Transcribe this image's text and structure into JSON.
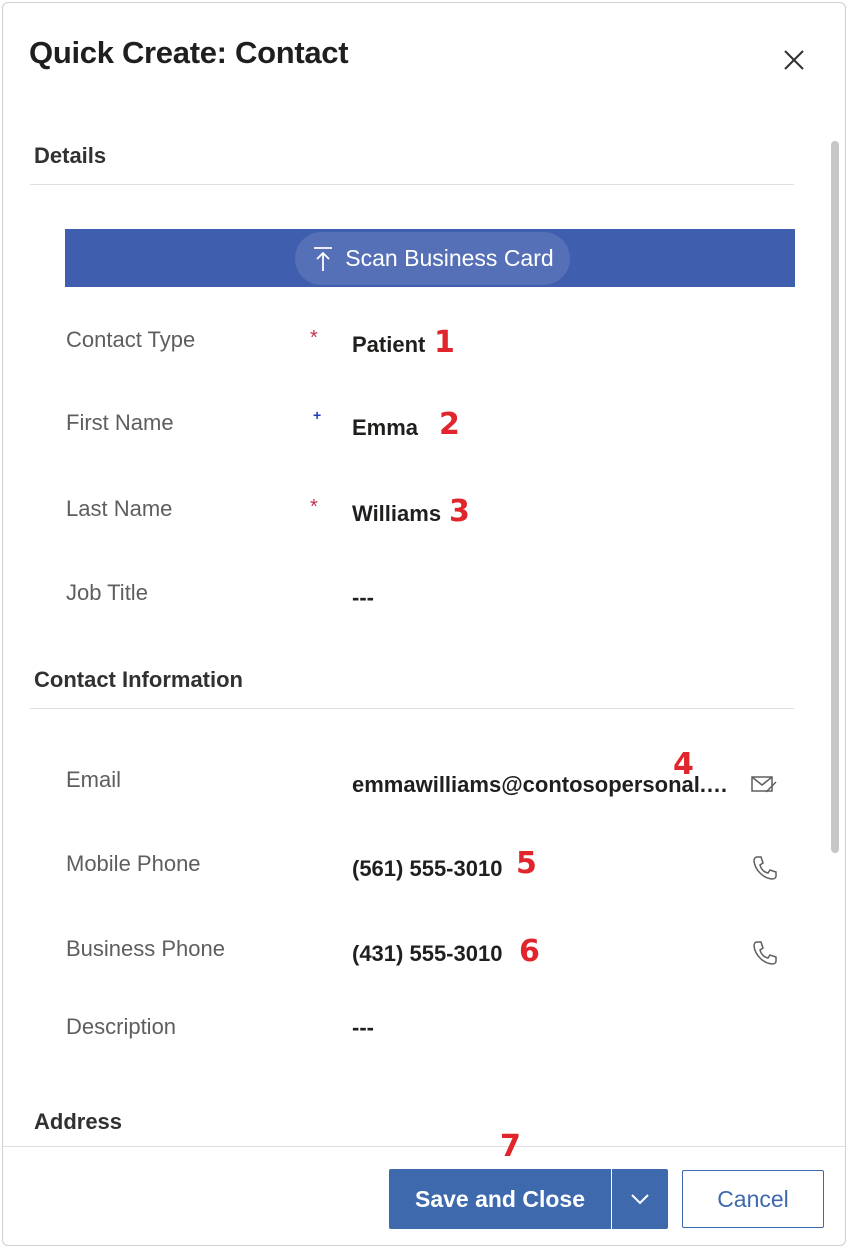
{
  "dialog": {
    "title": "Quick Create: Contact",
    "close_icon": "close-icon"
  },
  "details": {
    "section_title": "Details",
    "scan_button_label": "Scan Business Card",
    "fields": [
      {
        "label": "Contact Type",
        "value": "Patient",
        "required": "*",
        "marker": "1"
      },
      {
        "label": "First Name",
        "value": "Emma",
        "recommended": "+",
        "marker": "2"
      },
      {
        "label": "Last Name",
        "value": "Williams",
        "required": "*",
        "marker": "3"
      },
      {
        "label": "Job Title",
        "value": "---"
      }
    ]
  },
  "contact_info": {
    "section_title": "Contact Information",
    "fields": [
      {
        "label": "Email",
        "value": "emmawilliams@contosopersonal.com",
        "marker": "4",
        "icon": "email-icon"
      },
      {
        "label": "Mobile Phone",
        "value": "(561) 555-3010",
        "marker": "5",
        "icon": "phone-icon"
      },
      {
        "label": "Business Phone",
        "value": "(431) 555-3010",
        "marker": "6",
        "icon": "phone-icon"
      },
      {
        "label": "Description",
        "value": "---"
      }
    ]
  },
  "address": {
    "section_title": "Address"
  },
  "footer": {
    "save_label": "Save and Close",
    "save_marker": "7",
    "dropdown_icon": "chevron-down-icon",
    "cancel_label": "Cancel"
  },
  "colors": {
    "primary": "#3e69ac",
    "scan_bar": "#3f5ead",
    "required": "#c4314b",
    "marker": "#e0262c"
  }
}
